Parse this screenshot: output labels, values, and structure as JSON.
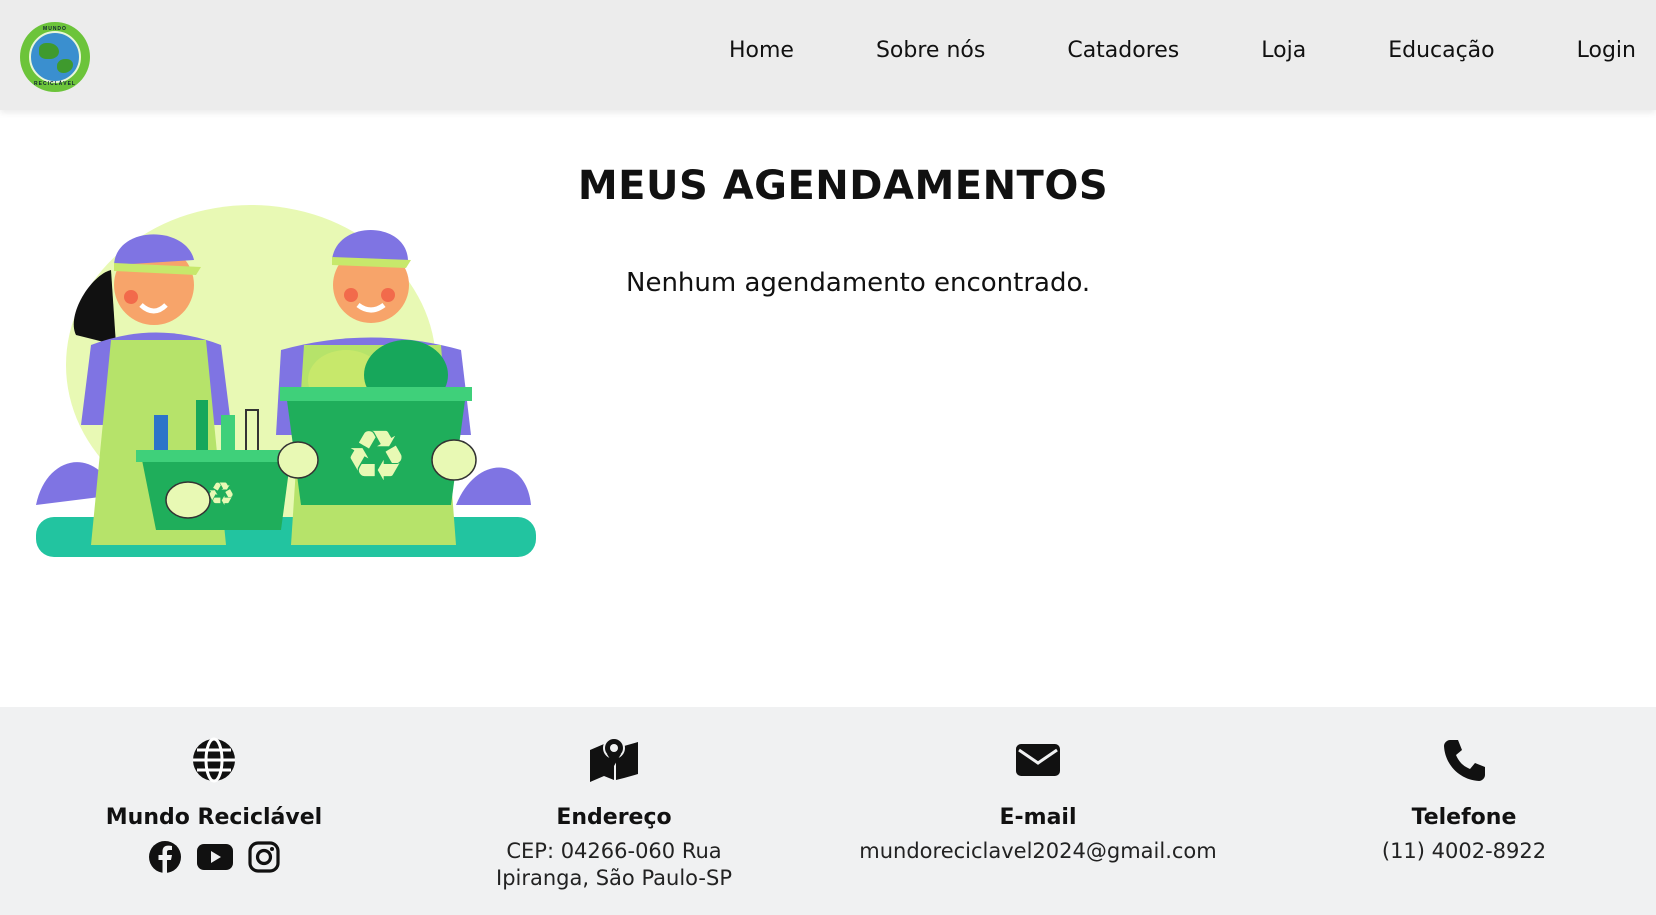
{
  "header": {
    "logo": {
      "top_text": "MUNDO",
      "bottom_text": "RECICLÁVEL"
    },
    "nav": [
      "Home",
      "Sobre nós",
      "Catadores",
      "Loja",
      "Educação",
      "Login"
    ]
  },
  "main": {
    "title": "MEUS AGENDAMENTOS",
    "empty_message": "Nenhum agendamento encontrado."
  },
  "footer": {
    "brand": {
      "icon": "globe-icon",
      "title": "Mundo Reciclável",
      "social": [
        "facebook-icon",
        "youtube-icon",
        "instagram-icon"
      ]
    },
    "address": {
      "icon": "map-icon",
      "title": "Endereço",
      "line1": "CEP: 04266-060 Rua",
      "line2": "Ipiranga, São Paulo-SP"
    },
    "email": {
      "icon": "envelope-icon",
      "title": "E-mail",
      "value": "mundoreciclavel2024@gmail.com"
    },
    "phone": {
      "icon": "phone-icon",
      "title": "Telefone",
      "value": "(11) 4002-8922"
    }
  },
  "colors": {
    "header_bg": "#ececec",
    "footer_bg": "#f0f1f2",
    "accent_green": "#1fae5b",
    "lime": "#e8f9b4",
    "purple": "#7f74e3"
  }
}
